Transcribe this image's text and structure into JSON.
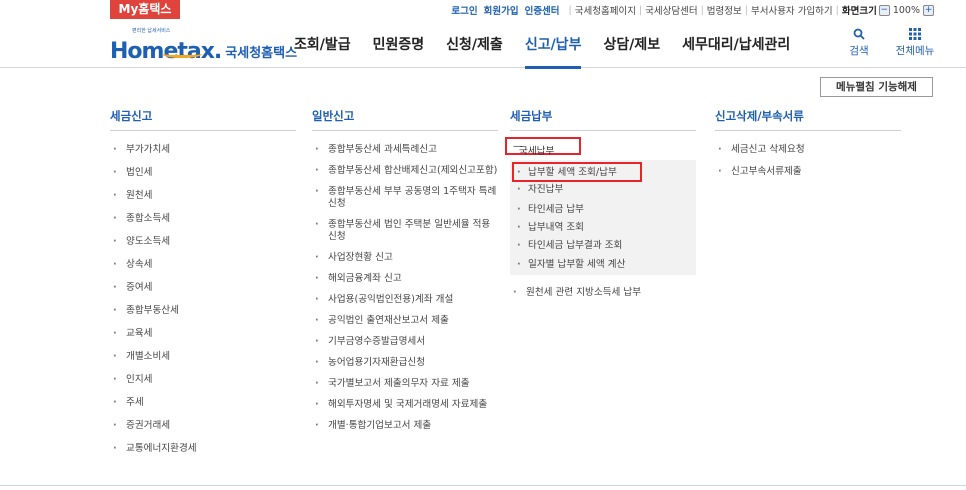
{
  "topbar": {
    "my_tab": "My홈택스",
    "links": [
      "로그인",
      "회원가입",
      "인증센터"
    ],
    "plain_links": [
      "국세청홈페이지",
      "국세상담센터",
      "법령정보",
      "부서사용자 가입하기"
    ],
    "zoom_label": "화면크기",
    "zoom_minus": "−",
    "zoom_value": "100%",
    "zoom_plus": "+"
  },
  "header": {
    "logo_small": "편리한 납세서비스",
    "logo_main": "Hometax.",
    "logo_sub": "국세청홈택스",
    "gnb": [
      "조회/발급",
      "민원증명",
      "신청/제출",
      "신고/납부",
      "상담/제보",
      "세무대리/납세관리"
    ],
    "active_gnb": "신고/납부",
    "search_label": "검색",
    "search_icon": "search-icon",
    "menu_label": "전체메뉴",
    "menu_icon": "grid-icon"
  },
  "fold_button": "메뉴펼침 기능해제",
  "columns": [
    {
      "title": "세금신고",
      "items": [
        "부가가치세",
        "법인세",
        "원천세",
        "종합소득세",
        "양도소득세",
        "상속세",
        "증여세",
        "종합부동산세",
        "교육세",
        "개별소비세",
        "인지세",
        "주세",
        "증권거래세",
        "교통에너지환경세"
      ]
    },
    {
      "title": "일반신고",
      "items": [
        "종합부동산세 과세특례신고",
        "종합부동산세 합산배제신고(제외신고포함)",
        "종합부동산세 부부 공동명의 1주택자 특례 신청",
        "종합부동산세 법인 주택분 일반세율 적용 신청",
        "사업장현황 신고",
        "해외금융계좌 신고",
        "사업용(공익법인전용)계좌 개설",
        "공익법인 출연재산보고서 제출",
        "기부금영수증발급명세서",
        "농어업용기자재환급신청",
        "국가별보고서 제출의무자 자료 제출",
        "해외투자명세 및 국제거래명세 자료제출",
        "개별·통합기업보고서 제출"
      ]
    },
    {
      "title": "세금납부",
      "open_item": "국세납부",
      "sub_items": [
        "납부할 세액 조회/납부",
        "자진납부",
        "타인세금 납부",
        "납부내역 조회",
        "타인세금 납부결과 조회",
        "일자별 납부할 세액 계산"
      ],
      "items": [
        "원천세 관련 지방소득세 납부"
      ]
    },
    {
      "title": "신고삭제/부속서류",
      "items": [
        "세금신고 삭제요청",
        "신고부속서류제출"
      ]
    }
  ],
  "colors": {
    "accent": "#1e5fb2",
    "brand_red": "#e0433b",
    "highlight": "#e8232b"
  }
}
